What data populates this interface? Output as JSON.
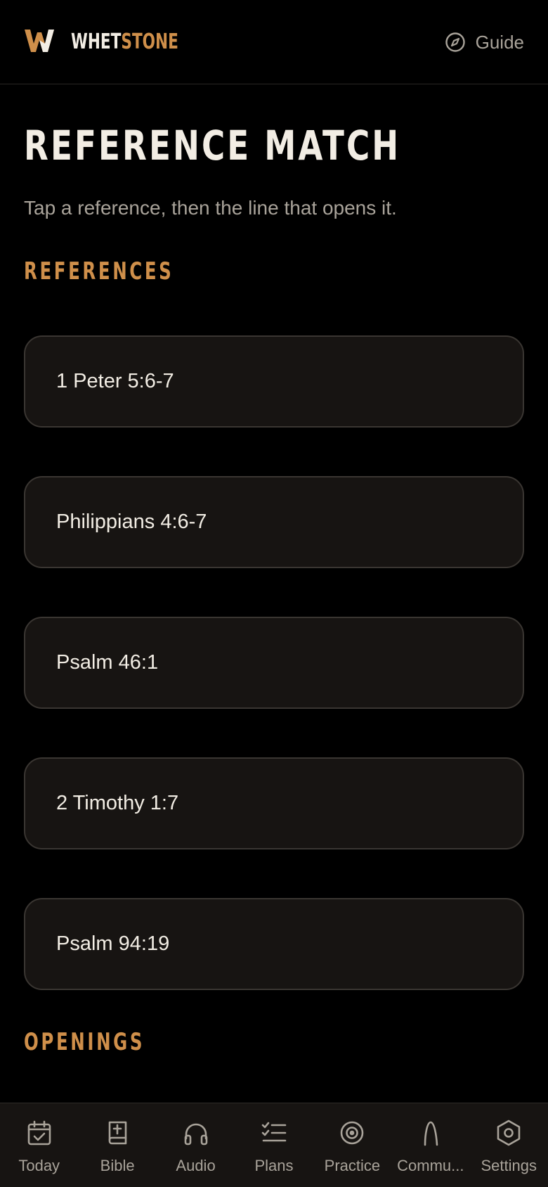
{
  "brand": {
    "name_part1": "WHET",
    "name_part2": "STONE",
    "accent": "#cf8f4a"
  },
  "header": {
    "guide_label": "Guide",
    "guide_icon": "compass-icon"
  },
  "page": {
    "title": "REFERENCE MATCH",
    "subtitle": "Tap a reference, then the line that opens it."
  },
  "sections": {
    "references_label": "REFERENCES",
    "openings_label": "OPENINGS"
  },
  "references": [
    {
      "label": "1 Peter 5:6-7"
    },
    {
      "label": "Philippians 4:6-7"
    },
    {
      "label": "Psalm 46:1"
    },
    {
      "label": "2 Timothy 1:7"
    },
    {
      "label": "Psalm 94:19"
    }
  ],
  "tabs": [
    {
      "label": "Today",
      "icon": "calendar-check-icon"
    },
    {
      "label": "Bible",
      "icon": "bible-icon"
    },
    {
      "label": "Audio",
      "icon": "headphones-icon"
    },
    {
      "label": "Plans",
      "icon": "checklist-icon"
    },
    {
      "label": "Practice",
      "icon": "target-icon"
    },
    {
      "label": "Commu...",
      "icon": "community-icon"
    },
    {
      "label": "Settings",
      "icon": "settings-hexagon-icon"
    }
  ],
  "colors": {
    "background": "#000000",
    "card": "#171412",
    "card_border": "#3a3632",
    "text_primary": "#f2ede4",
    "text_muted": "#a9a39a"
  }
}
